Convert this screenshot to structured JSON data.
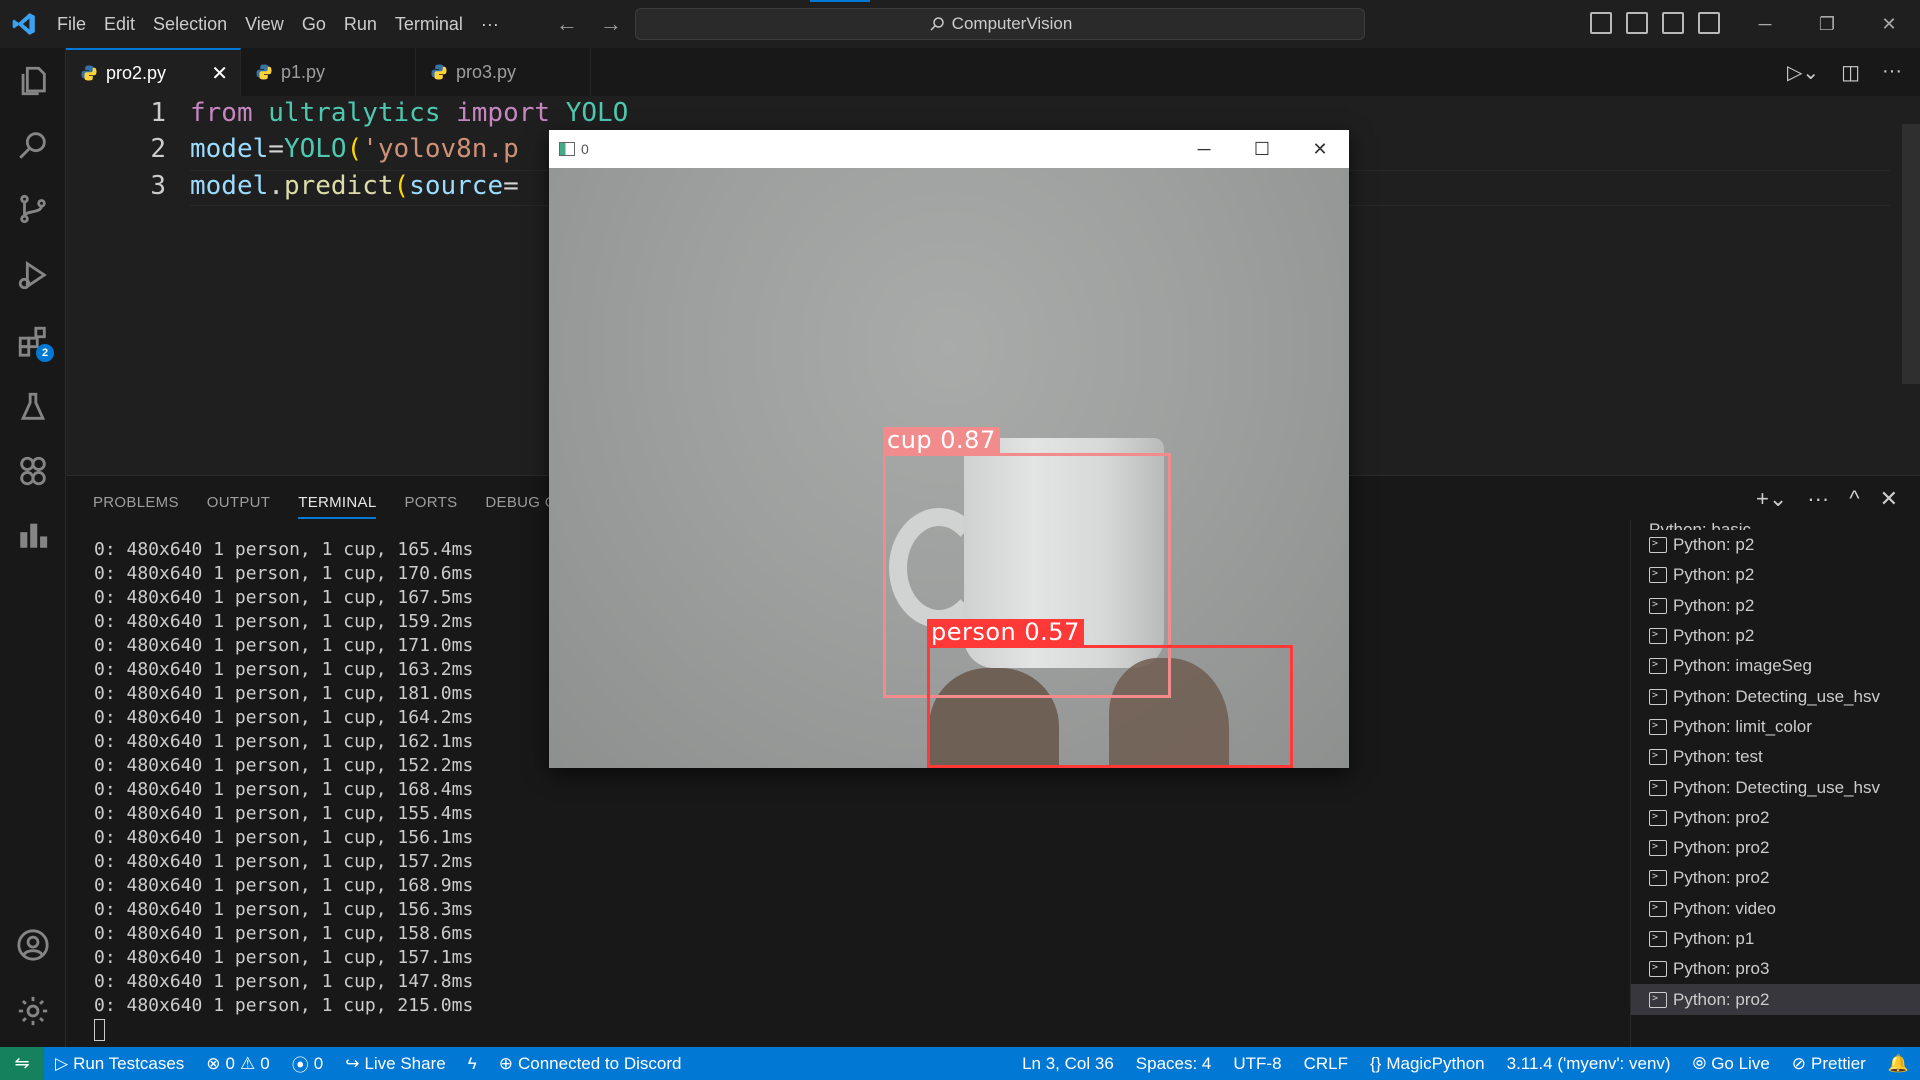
{
  "menu": [
    "File",
    "Edit",
    "Selection",
    "View",
    "Go",
    "Run",
    "Terminal",
    "···"
  ],
  "search": {
    "label": "ComputerVision"
  },
  "tabs": [
    {
      "label": "pro2.py",
      "active": true
    },
    {
      "label": "p1.py",
      "active": false
    },
    {
      "label": "pro3.py",
      "active": false
    }
  ],
  "extensions_badge": "2",
  "editor": {
    "line_numbers": [
      "1",
      "2",
      "3"
    ],
    "line1": {
      "kw1": "from",
      "mod": "ultralytics",
      "kw2": "import",
      "cls": "YOLO"
    },
    "line2": {
      "var": "model",
      "eq": "=",
      "cls": "YOLO",
      "open": "(",
      "str": "'yolov8n.p"
    },
    "line3": {
      "var": "model",
      "dot": ".",
      "fn": "predict",
      "open": "(",
      "param": "source",
      "eq": "="
    }
  },
  "panel": {
    "tabs": [
      "PROBLEMS",
      "OUTPUT",
      "TERMINAL",
      "PORTS",
      "DEBUG CON"
    ],
    "active_tab": "TERMINAL",
    "terminal_lines": [
      "0: 480x640 1 person, 1 cup, 165.4ms",
      "0: 480x640 1 person, 1 cup, 170.6ms",
      "0: 480x640 1 person, 1 cup, 167.5ms",
      "0: 480x640 1 person, 1 cup, 159.2ms",
      "0: 480x640 1 person, 1 cup, 171.0ms",
      "0: 480x640 1 person, 1 cup, 163.2ms",
      "0: 480x640 1 person, 1 cup, 181.0ms",
      "0: 480x640 1 person, 1 cup, 164.2ms",
      "0: 480x640 1 person, 1 cup, 162.1ms",
      "0: 480x640 1 person, 1 cup, 152.2ms",
      "0: 480x640 1 person, 1 cup, 168.4ms",
      "0: 480x640 1 person, 1 cup, 155.4ms",
      "0: 480x640 1 person, 1 cup, 156.1ms",
      "0: 480x640 1 person, 1 cup, 157.2ms",
      "0: 480x640 1 person, 1 cup, 168.9ms",
      "0: 480x640 1 person, 1 cup, 156.3ms",
      "0: 480x640 1 person, 1 cup, 158.6ms",
      "0: 480x640 1 person, 1 cup, 157.1ms",
      "0: 480x640 1 person, 1 cup, 147.8ms",
      "0: 480x640 1 person, 1 cup, 215.0ms"
    ],
    "terminal_list": [
      "Python: p2",
      "Python: p2",
      "Python: p2",
      "Python: p2",
      "Python: imageSeg",
      "Python: Detecting_use_hsv",
      "Python: limit_color",
      "Python: test",
      "Python: Detecting_use_hsv",
      "Python: pro2",
      "Python: pro2",
      "Python: pro2",
      "Python: video",
      "Python: p1",
      "Python: pro3",
      "Python: pro2"
    ],
    "terminal_list_partial": "Python: basic"
  },
  "camera_window": {
    "title": "0",
    "detections": [
      {
        "label": "cup 0.87",
        "color": "#f28c8c"
      },
      {
        "label": "person 0.57",
        "color": "#ff3838"
      }
    ]
  },
  "status": {
    "run_testcases": "Run Testcases",
    "errors": "0",
    "warnings": "0",
    "ports": "0",
    "live_share": "Live Share",
    "discord": "Connected to Discord",
    "position": "Ln 3, Col 36",
    "spaces": "Spaces: 4",
    "encoding": "UTF-8",
    "eol": "CRLF",
    "language": "MagicPython",
    "interpreter": "3.11.4 ('myenv': venv)",
    "go_live": "Go Live",
    "prettier": "Prettier"
  },
  "colors": {
    "accent": "#0078d4",
    "status_bar": "#0078d4",
    "remote": "#16825d"
  }
}
